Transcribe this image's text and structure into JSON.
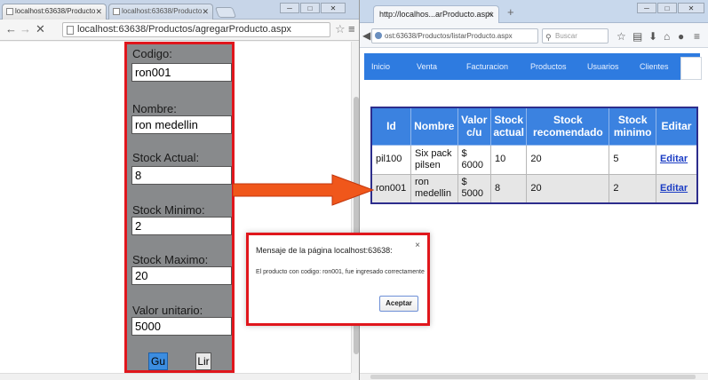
{
  "left_browser": {
    "tabs": [
      {
        "title": "localhost:63638/Producto"
      },
      {
        "title": "localhost:63638/Producto"
      }
    ],
    "url_prefix": "localhost:63638/Productos/agregarProducto.aspx",
    "url_dim": "",
    "form": {
      "codigo_label": "Codigo:",
      "codigo_value": "ron001",
      "nombre_label": "Nombre:",
      "nombre_value": "ron medellin",
      "stock_actual_label": "Stock Actual:",
      "stock_actual_value": "8",
      "stock_minimo_label": "Stock Minimo:",
      "stock_minimo_value": "2",
      "stock_maximo_label": "Stock Maximo:",
      "stock_maximo_value": "20",
      "valor_label": "Valor unitario:",
      "valor_value": "5000",
      "guardar_label": "Gu",
      "limpiar_label": "Lir"
    }
  },
  "right_browser": {
    "tab_title": "http://localhos...arProducto.aspx",
    "url": "ost:63638/Productos/listarProducto.aspx",
    "search_placeholder": "Buscar",
    "menu": [
      "Inicio",
      "Venta",
      "Facturacion",
      "Productos",
      "Usuarios",
      "Clientes"
    ],
    "table": {
      "headers": [
        "Id",
        "Nombre",
        "Valor c/u",
        "Stock actual",
        "Stock recomendado",
        "Stock minimo",
        "Editar"
      ],
      "rows": [
        [
          "pil100",
          "Six pack pilsen",
          "$ 6000",
          "10",
          "20",
          "5",
          "Editar"
        ],
        [
          "ron001",
          "ron medellin",
          "$ 5000",
          "8",
          "20",
          "2",
          "Editar"
        ]
      ]
    }
  },
  "dialog": {
    "title": "Mensaje de la página localhost:63638:",
    "message": "El producto con codigo: ron001, fue ingresado correctamente",
    "ok_label": "Aceptar",
    "close_glyph": "×"
  },
  "colors": {
    "highlight": "#e0161c",
    "menu_bar": "#2e7be0",
    "table_header": "#3b82e0",
    "arrow_fill": "#f0571b"
  }
}
